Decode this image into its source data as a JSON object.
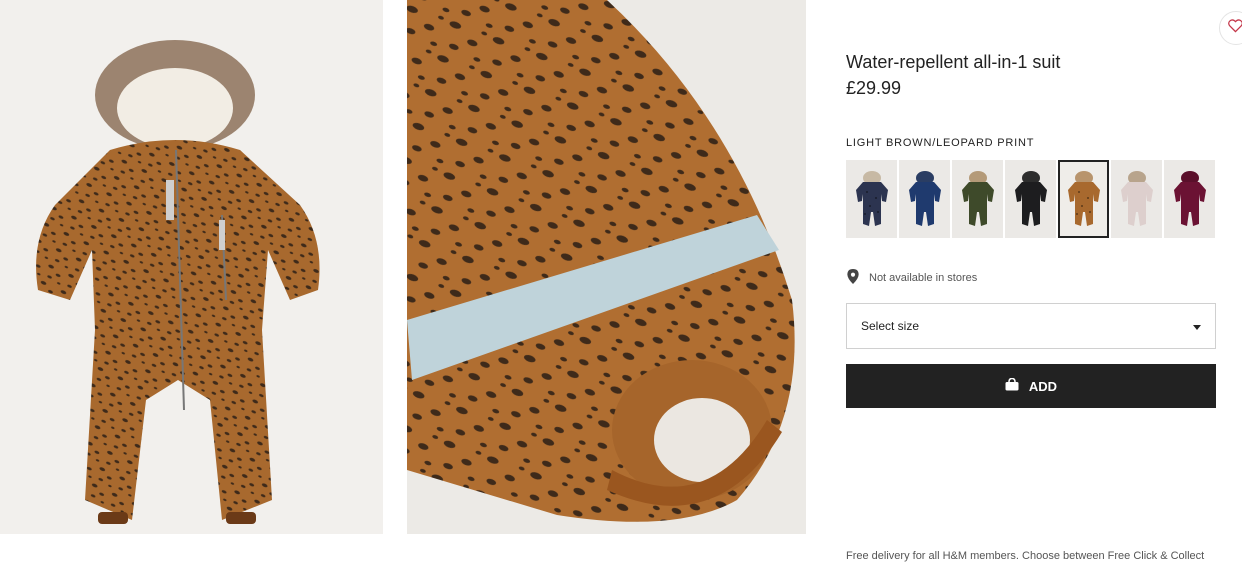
{
  "product": {
    "title": "Water-repellent all-in-1 suit",
    "price": "£29.99",
    "color_label": "LIGHT BROWN/LEOPARD PRINT"
  },
  "swatches": [
    {
      "color": "#2c3450",
      "accent": "#c7b9a4",
      "pattern": "print"
    },
    {
      "color": "#1f3a6e",
      "accent": "#2a3d63",
      "pattern": "solid"
    },
    {
      "color": "#3e4a2a",
      "accent": "#b49a78",
      "pattern": "solid"
    },
    {
      "color": "#1d1d1f",
      "accent": "#2d2d2d",
      "pattern": "solid"
    },
    {
      "color": "#a8692e",
      "accent": "#b8946c",
      "pattern": "print"
    },
    {
      "color": "#ddcfcd",
      "accent": "#b8a48c",
      "pattern": "solid"
    },
    {
      "color": "#6b1233",
      "accent": "#5a0f2a",
      "pattern": "solid"
    }
  ],
  "selected_swatch": 4,
  "availability": {
    "icon": "location-pin-icon",
    "text": "Not available in stores"
  },
  "size_select": {
    "label": "Select size",
    "icon": "caret-down-icon"
  },
  "add_button": {
    "label": "ADD",
    "icon": "shopping-bag-icon"
  },
  "wishlist": {
    "icon": "heart-icon",
    "color": "#c4374a"
  },
  "delivery_note": "Free delivery for all H&M members. Choose between Free Click & Collect",
  "colors": {
    "button_bg": "#222222",
    "suit_brown": "#a8692e",
    "spot": "#3e2a1a"
  }
}
